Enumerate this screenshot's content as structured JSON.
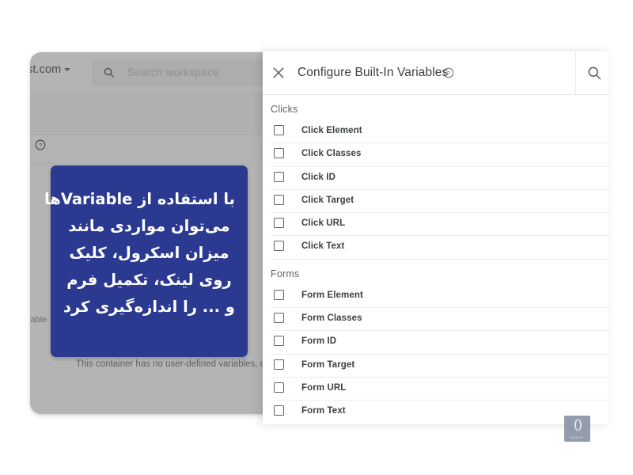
{
  "background_app": {
    "account_label": "st.com",
    "caret_icon": "chevron-down-icon",
    "search": {
      "icon": "search-icon",
      "placeholder": "Search workspace"
    },
    "help_icon": "help-circle-icon",
    "variables_label": "iable",
    "empty_state_message": "This container has no user-defined variables, click th"
  },
  "callout": {
    "background_color": "#2b3990",
    "text_color": "#ffffff",
    "lines": [
      "با استفاده از Variableها",
      "می‌توان مواردی مانند",
      "میزان اسکرول، کلیک",
      "روی لینک، تکمیل فرم",
      "و ... را اندازه‌گیری کرد"
    ]
  },
  "panel": {
    "close_icon": "close-icon",
    "title": "Configure Built-In Variables",
    "title_info_icon": "help-circle-icon",
    "search_icon": "search-icon",
    "sections": [
      {
        "title": "Clicks",
        "options": [
          {
            "label": "Click Element",
            "checked": false
          },
          {
            "label": "Click Classes",
            "checked": false
          },
          {
            "label": "Click ID",
            "checked": false
          },
          {
            "label": "Click Target",
            "checked": false
          },
          {
            "label": "Click URL",
            "checked": false
          },
          {
            "label": "Click Text",
            "checked": false
          }
        ]
      },
      {
        "title": "Forms",
        "options": [
          {
            "label": "Form Element",
            "checked": false
          },
          {
            "label": "Form Classes",
            "checked": false
          },
          {
            "label": "Form ID",
            "checked": false
          },
          {
            "label": "Form Target",
            "checked": false
          },
          {
            "label": "Form URL",
            "checked": false
          },
          {
            "label": "Form Text",
            "checked": false
          }
        ]
      }
    ]
  },
  "watermark": {
    "icon": "double-loop-logo-icon",
    "glyph": "()",
    "wordmark": "NEMUD"
  }
}
